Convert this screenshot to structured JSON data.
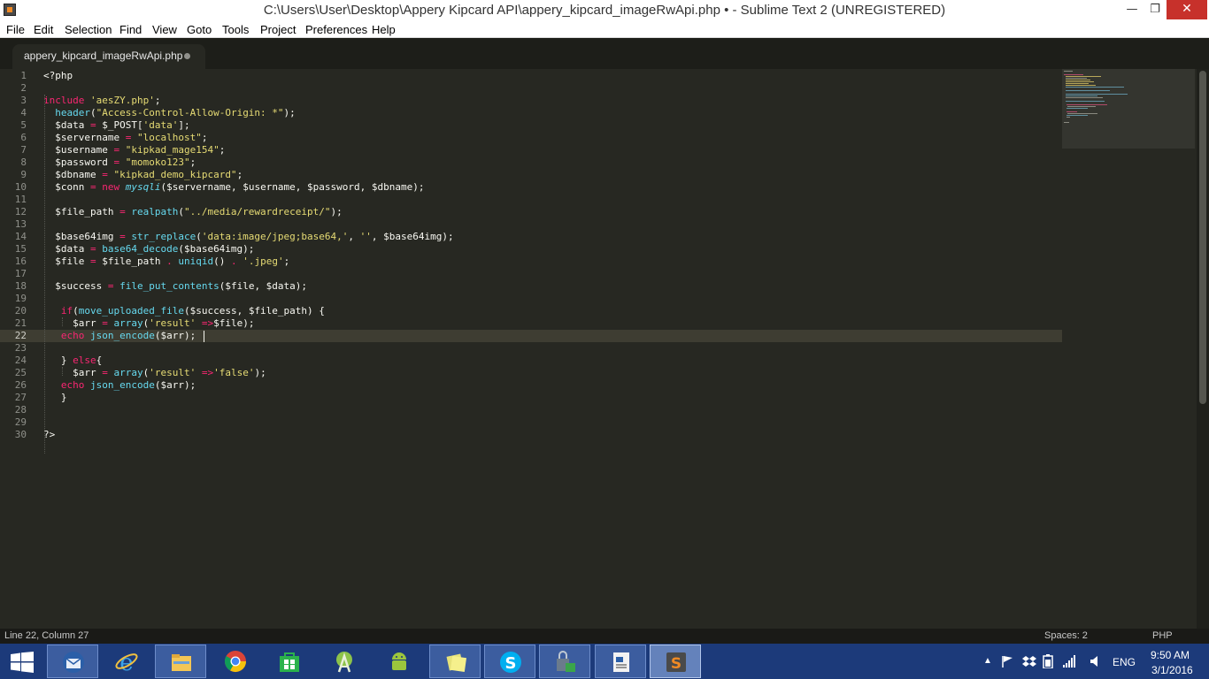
{
  "window": {
    "title": "C:\\Users\\User\\Desktop\\Appery Kipcard API\\appery_kipcard_imageRwApi.php • - Sublime Text 2 (UNREGISTERED)",
    "minimize_glyph": "—",
    "maximize_glyph": "❐",
    "close_glyph": "✕"
  },
  "menu": [
    "File",
    "Edit",
    "Selection",
    "Find",
    "View",
    "Goto",
    "Tools",
    "Project",
    "Preferences",
    "Help"
  ],
  "tab": {
    "label": "appery_kipcard_imageRwApi.php",
    "modified": true
  },
  "editor": {
    "active_line": 22,
    "lines": [
      "<?php",
      "",
      "include 'aesZY.php';",
      "  header(\"Access-Control-Allow-Origin: *\");",
      "  $data = $_POST['data'];",
      "  $servername = \"localhost\";",
      "  $username = \"kipkad_mage154\";",
      "  $password = \"momoko123\";",
      "  $dbname = \"kipkad_demo_kipcard\";",
      "  $conn = new mysqli($servername, $username, $password, $dbname);",
      "",
      "  $file_path = realpath(\"../media/rewardreceipt/\");",
      "",
      "  $base64img = str_replace('data:image/jpeg;base64,', '', $base64img);",
      "  $data = base64_decode($base64img);",
      "  $file = $file_path . uniqid() . '.jpeg';",
      "",
      "  $success = file_put_contents($file, $data);",
      "",
      "   if(move_uploaded_file($success, $file_path) {",
      "     $arr = array('result' =>$file);",
      "   echo json_encode($arr);",
      "",
      "   } else{",
      "     $arr = array('result' =>'false');",
      "   echo json_encode($arr);",
      "   }",
      "",
      "",
      "?>"
    ]
  },
  "status": {
    "position": "Line 22, Column 27",
    "indent": "Spaces: 2",
    "syntax": "PHP"
  },
  "taskbar": {
    "apps": [
      {
        "name": "Thunderbird",
        "icon": "thunderbird-icon",
        "open": true
      },
      {
        "name": "Internet Explorer",
        "icon": "ie-icon",
        "open": false
      },
      {
        "name": "File Explorer",
        "icon": "folder-icon",
        "open": true
      },
      {
        "name": "Google Chrome",
        "icon": "chrome-icon",
        "open": false
      },
      {
        "name": "Store",
        "icon": "store-icon",
        "open": false
      },
      {
        "name": "Android Studio",
        "icon": "android-studio-icon",
        "open": false
      },
      {
        "name": "Android SDK",
        "icon": "android-icon",
        "open": false
      },
      {
        "name": "Sticky Notes",
        "icon": "sticky-notes-icon",
        "open": true
      },
      {
        "name": "Skype",
        "icon": "skype-icon",
        "open": true
      },
      {
        "name": "Tool",
        "icon": "lock-tool-icon",
        "open": true
      },
      {
        "name": "Document",
        "icon": "document-icon",
        "open": true
      },
      {
        "name": "Sublime Text",
        "icon": "sublime-icon",
        "open": true,
        "active": true
      }
    ],
    "language": "ENG",
    "time": "9:50 AM",
    "date": "3/1/2016",
    "colors": {
      "taskbar": "#1c3a7a",
      "close_button": "#c7312b"
    }
  }
}
